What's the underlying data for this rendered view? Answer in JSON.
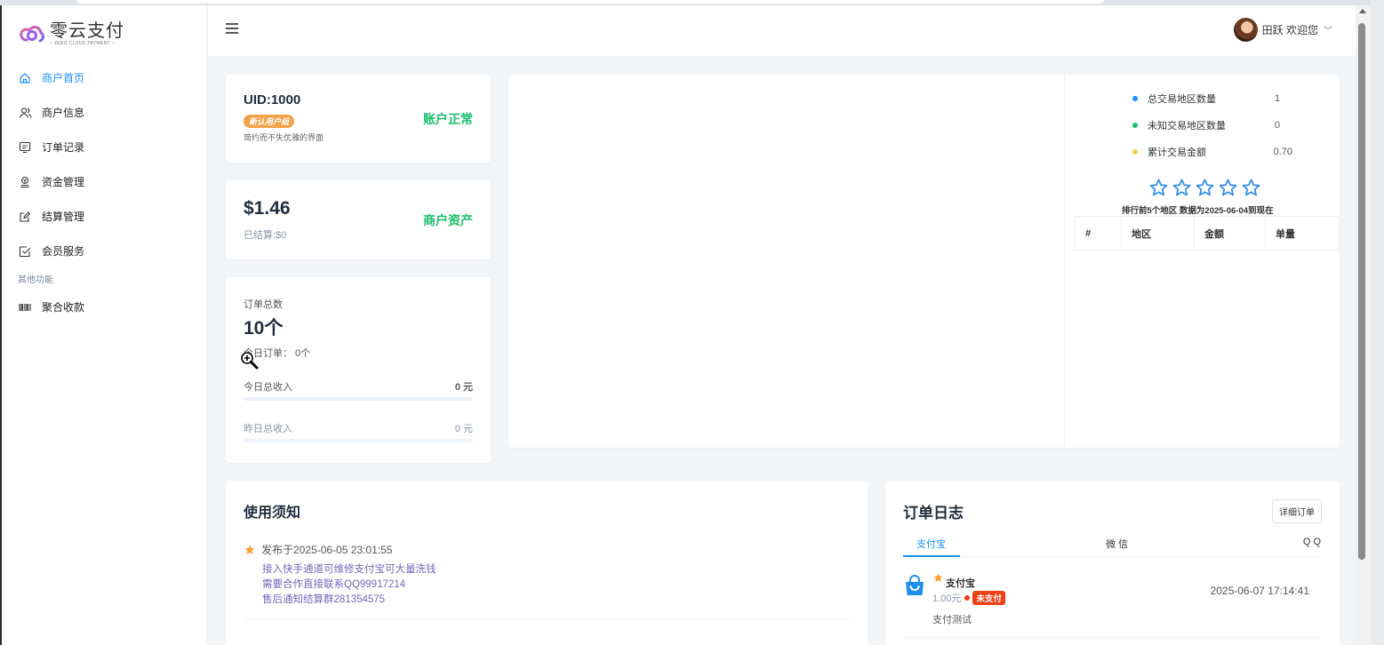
{
  "brand": {
    "name": "零云支付",
    "sub": "~ ZERO CLOUD PAYMENT ~"
  },
  "sidebar": {
    "items": [
      {
        "label": "商户首页",
        "icon": "home-icon",
        "active": true
      },
      {
        "label": "商户信息",
        "icon": "users-icon"
      },
      {
        "label": "订单记录",
        "icon": "order-icon"
      },
      {
        "label": "资金管理",
        "icon": "funds-icon"
      },
      {
        "label": "结算管理",
        "icon": "edit-icon"
      },
      {
        "label": "会员服务",
        "icon": "check-square-icon"
      }
    ],
    "group_label": "其他功能",
    "extra_items": [
      {
        "label": "聚合收款",
        "icon": "barcode-icon"
      }
    ]
  },
  "header": {
    "user_greeting": "田跃 欢迎您",
    "menu_icon": "hamburger-icon"
  },
  "account_card": {
    "uid": "UID:1000",
    "tag": "新认用户组",
    "tagline": "简约而不失优雅的界面",
    "status": "账户正常"
  },
  "asset_card": {
    "balance": "$1.46",
    "settled": "已结算:$0",
    "label": "商户资产"
  },
  "orders_card": {
    "title": "订单总数",
    "count": "10个",
    "today": "今日订单： 0个",
    "income_today_label": "今日总收入",
    "income_today_value": "0 元",
    "income_yesterday_label": "昨日总收入",
    "income_yesterday_value": "0 元"
  },
  "region_stats": {
    "rows": [
      {
        "label": "总交易地区数量",
        "value": "1",
        "color": "#1890ff"
      },
      {
        "label": "未知交易地区数量",
        "value": "0",
        "color": "#19be6b"
      },
      {
        "label": "累计交易金额",
        "value": "0.70",
        "color": "#f7c948"
      }
    ],
    "star_color": "#2d8cf0",
    "rank_note": "排行前5个地区  数据为2025-06-04到现在",
    "table_headers": [
      "#",
      "地区",
      "金额",
      "单量"
    ]
  },
  "notice": {
    "title": "使用须知",
    "posted": "发布于2025-06-05 23:01:55",
    "lines": [
      "接入快手通道可维修支付宝可大量洗钱",
      "需要合作直接联系QQ99917214",
      "售后通知结算群281354575"
    ]
  },
  "order_log": {
    "title": "订单日志",
    "detail_button": "详细订单",
    "tabs": [
      "支付宝",
      "微 信",
      "Q Q"
    ],
    "item": {
      "name": "支付宝",
      "amount": "1.00元",
      "status": "未支付",
      "desc": "支付测试",
      "time": "2025-06-07 17:14:41"
    }
  }
}
